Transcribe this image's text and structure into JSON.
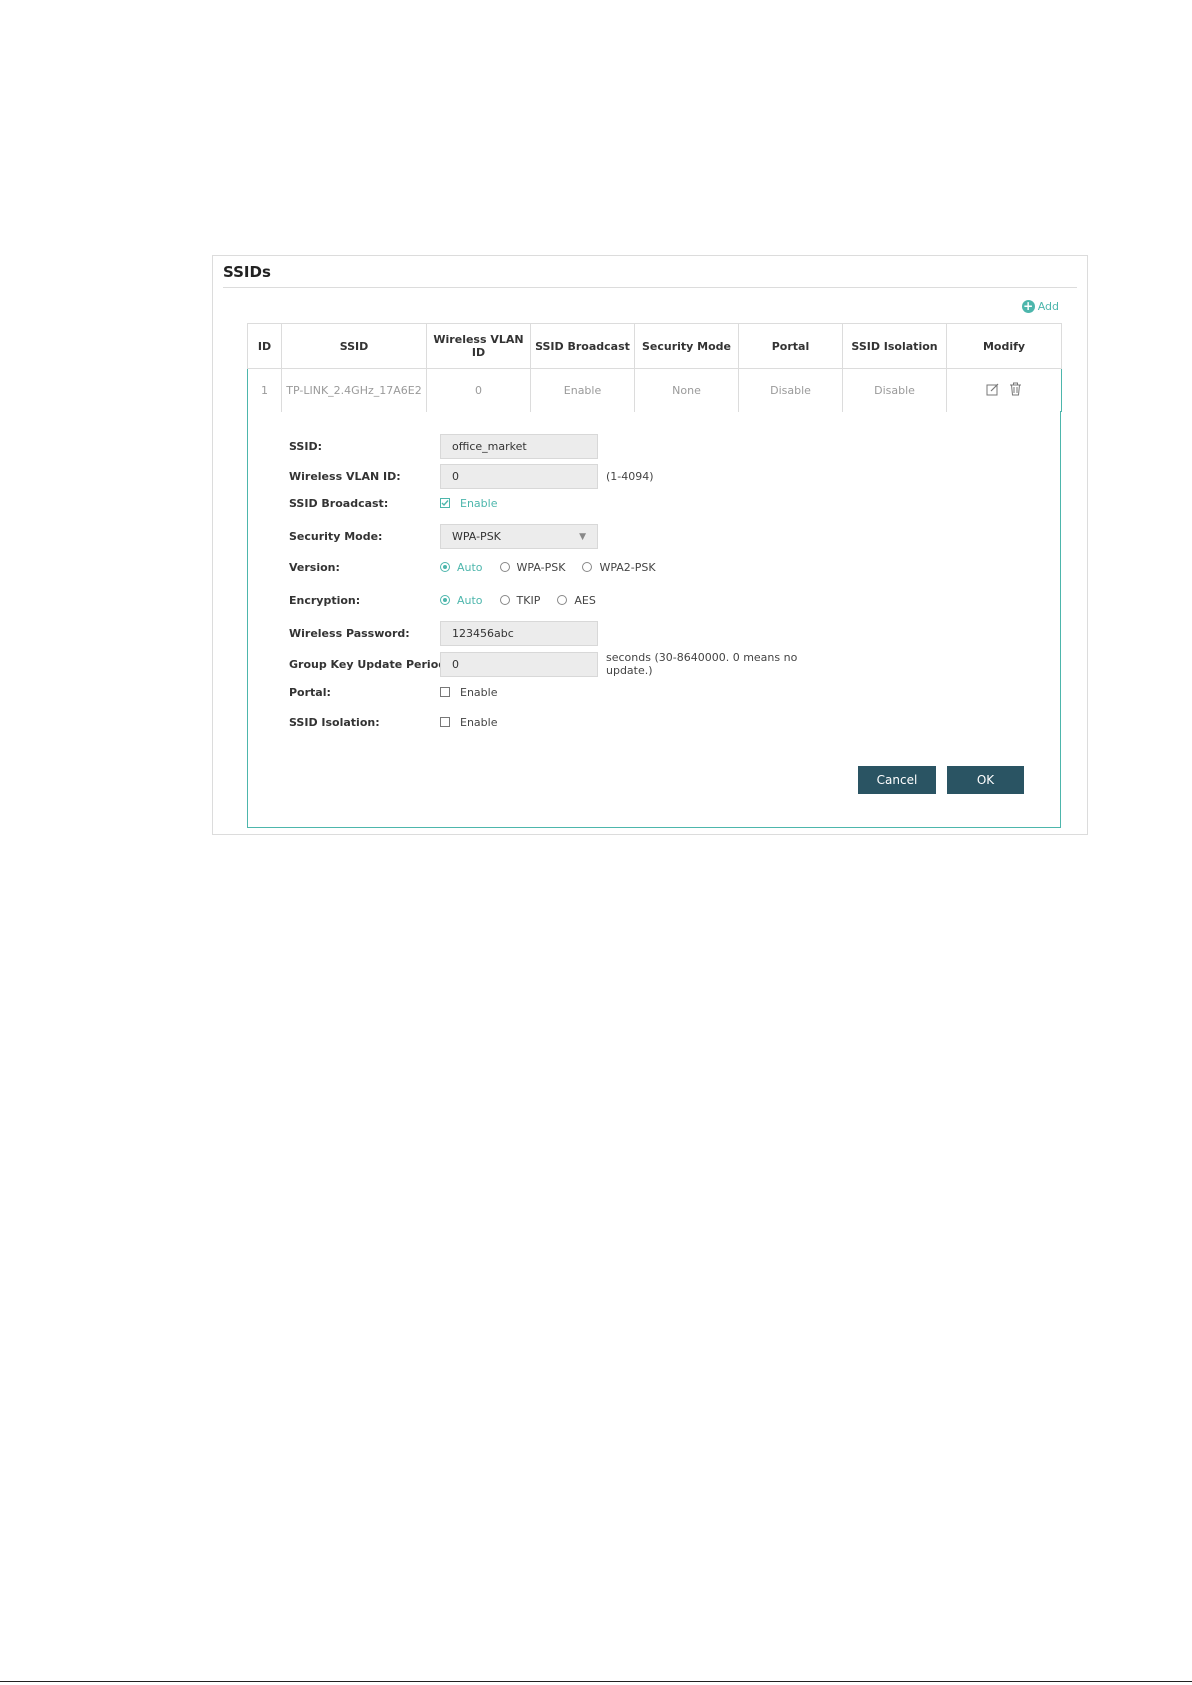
{
  "panel": {
    "title": "SSIDs",
    "add_label": "Add"
  },
  "table": {
    "headers": [
      "ID",
      "SSID",
      "Wireless VLAN ID",
      "SSID Broadcast",
      "Security Mode",
      "Portal",
      "SSID Isolation",
      "Modify"
    ],
    "rows": [
      [
        "1",
        "TP-LINK_2.4GHz_17A6E2",
        "0",
        "Enable",
        "None",
        "Disable",
        "Disable"
      ]
    ]
  },
  "form": {
    "ssid": {
      "label": "SSID:",
      "value": "office_market"
    },
    "vlan": {
      "label": "Wireless VLAN ID:",
      "value": "0",
      "hint": "(1-4094)"
    },
    "broadcast": {
      "label": "SSID Broadcast:",
      "option": "Enable",
      "checked": true
    },
    "security": {
      "label": "Security Mode:",
      "value": "WPA-PSK"
    },
    "version": {
      "label": "Version:",
      "options": [
        "Auto",
        "WPA-PSK",
        "WPA2-PSK"
      ],
      "selected": "Auto"
    },
    "encryption": {
      "label": "Encryption:",
      "options": [
        "Auto",
        "TKIP",
        "AES"
      ],
      "selected": "Auto"
    },
    "password": {
      "label": "Wireless Password:",
      "value": "123456abc"
    },
    "group_key": {
      "label": "Group Key Update Period:",
      "value": "0",
      "hint": "seconds (30-8640000. 0 means no update.)"
    },
    "portal": {
      "label": "Portal:",
      "option": "Enable",
      "checked": false
    },
    "isolation": {
      "label": "SSID Isolation:",
      "option": "Enable",
      "checked": false
    }
  },
  "buttons": {
    "cancel": "Cancel",
    "ok": "OK"
  },
  "colors": {
    "accent": "#4db6ac",
    "button": "#2a5463"
  }
}
